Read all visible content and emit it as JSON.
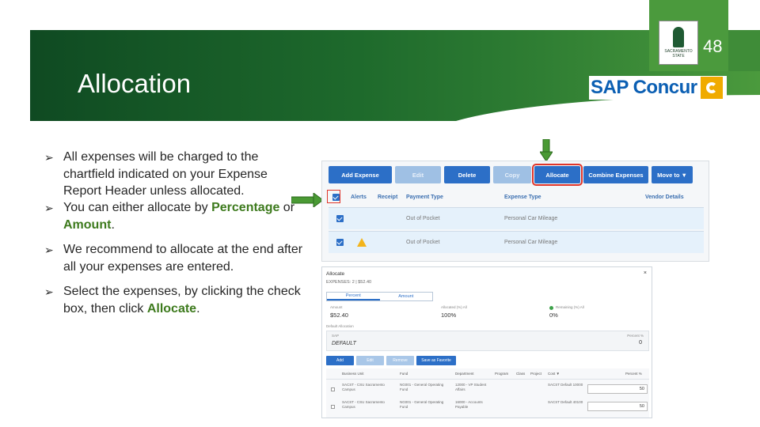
{
  "slide": {
    "title": "Allocation",
    "number": "48"
  },
  "logos": {
    "university_seal_text": "SACRAMENTO STATE",
    "concur_text": "SAP Concur"
  },
  "bullets": [
    {
      "text": "All expenses will be charged to the chartfield indicated on your Expense Report Header unless allocated."
    },
    {
      "before": "You can either allocate by ",
      "hl1": "Percentage",
      "mid": " or ",
      "hl2": "Amount",
      "after": "."
    },
    {
      "text": "We recommend to allocate at the end after all your expenses are entered."
    },
    {
      "before": "Select the expenses, by clicking the check box, then click ",
      "hl1": "Allocate",
      "after": "."
    }
  ],
  "expense_list": {
    "toolbar": {
      "add_expense": "Add Expense",
      "edit": "Edit",
      "delete": "Delete",
      "copy": "Copy",
      "allocate": "Allocate",
      "combine_expenses": "Combine Expenses",
      "move_to": "Move to ▼"
    },
    "columns": {
      "alerts": "Alerts",
      "receipt": "Receipt",
      "payment_type": "Payment Type",
      "expense_type": "Expense Type",
      "vendor_details": "Vendor Details"
    },
    "rows": [
      {
        "payment_type": "Out of Pocket",
        "expense_type": "Personal Car Mileage"
      },
      {
        "payment_type": "Out of Pocket",
        "expense_type": "Personal Car Mileage"
      }
    ]
  },
  "allocate_dialog": {
    "title": "Allocate",
    "close": "×",
    "subtitle": "EXPENSES: 2   |   $52.40",
    "tabs": {
      "percent": "Percent",
      "amount": "Amount"
    },
    "amount_label": "Amount",
    "amount_value": "$52.40",
    "allocated_label": "Allocated (%) All",
    "allocated_value": "100%",
    "remaining_label": "Remaining (%) All",
    "remaining_value": "0%",
    "default_allocation_label": "Default Allocation",
    "sap_label": "SAP",
    "sap_value": "DEFAULT",
    "percent_label": "Percent %",
    "percent_value": "0",
    "buttons": {
      "add": "Add",
      "edit": "Edit",
      "remove": "Remove",
      "save_favorite": "Save as Favorite"
    },
    "grid_columns": {
      "business_unit": "Business Unit",
      "fund": "Fund",
      "department": "Department",
      "program": "Program",
      "class": "Class",
      "project": "Project",
      "cost": "Cost ▼",
      "percent": "Percent %"
    },
    "grid_rows": [
      {
        "business_unit": "SACST - CSU Sacramento Campus",
        "fund": "NG001 - General Operating Fund",
        "department": "12000 - VP Student Affairs",
        "cost": "SACST Default 10000",
        "percent": "50"
      },
      {
        "business_unit": "SACST - CSU Sacramento Campus",
        "fund": "NG001 - General Operating Fund",
        "department": "16000 - Accounts Payable",
        "cost": "SACST Default 40100",
        "percent": "50"
      }
    ]
  },
  "colors": {
    "banner_dark": "#0f4a22",
    "banner_light": "#4b9a3d",
    "highlight_text": "#3d7a1d",
    "concur_blue": "#0b5fb3",
    "concur_orange": "#f0ab00",
    "button_blue": "#2c6fc7",
    "callout_red": "#e0352a"
  }
}
